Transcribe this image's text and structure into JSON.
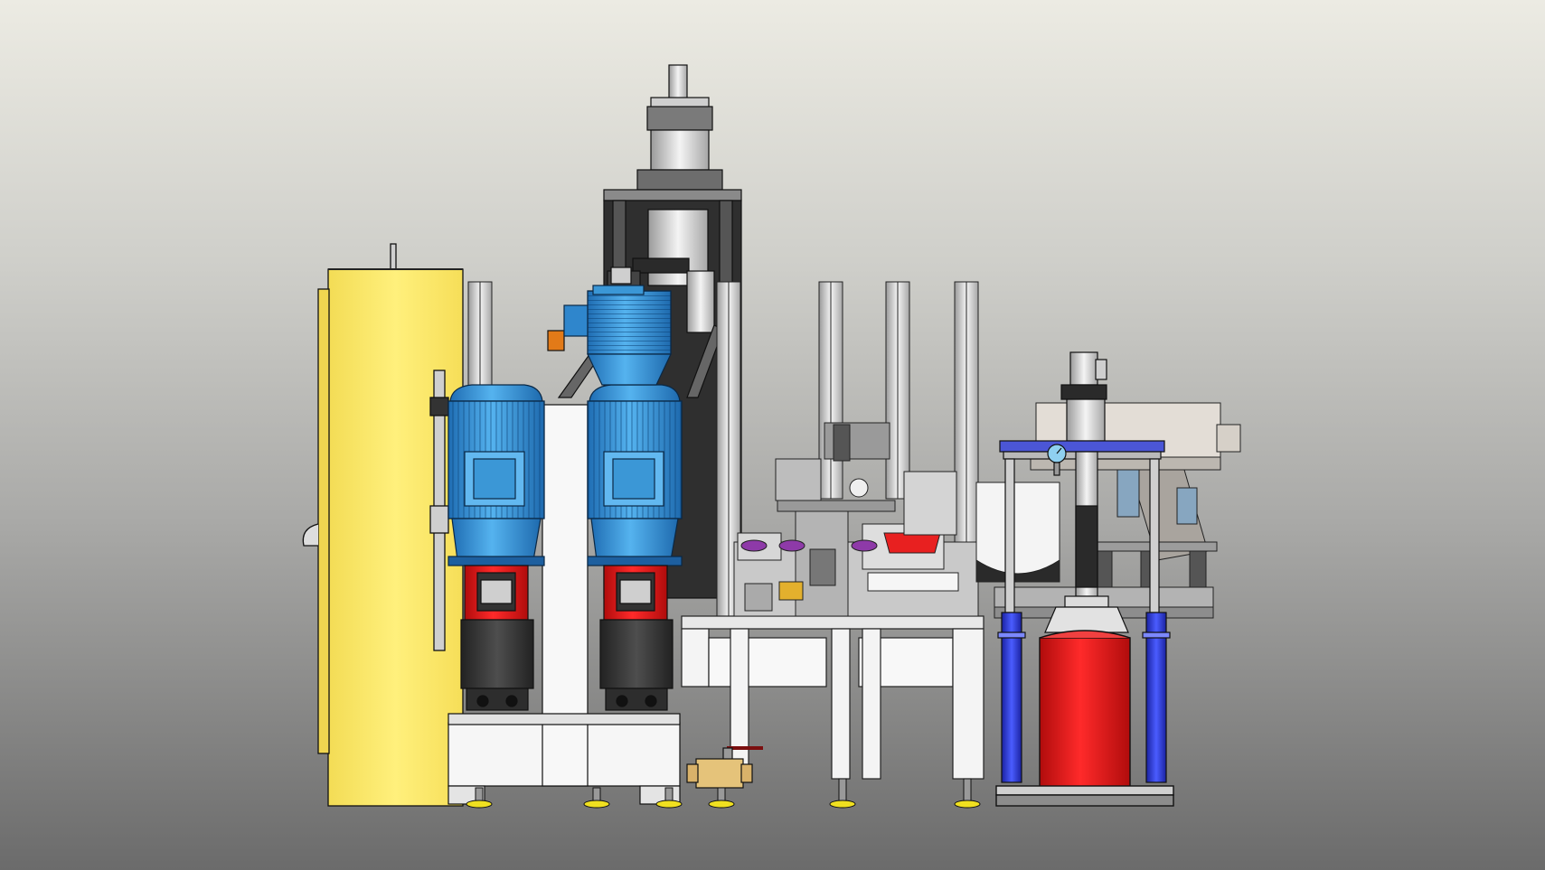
{
  "scene": {
    "kind": "CAD machine assembly render",
    "background": {
      "top": "#ecebe3",
      "bottom": "#6b6b6b"
    },
    "components": [
      {
        "name": "electrical-cabinet",
        "color": "#fde96a"
      },
      {
        "name": "motor-1",
        "color": "#3d9ad8"
      },
      {
        "name": "motor-2",
        "color": "#3d9ad8"
      },
      {
        "name": "top-motor",
        "color": "#3d9ad8"
      },
      {
        "name": "coupling-1",
        "color": "#d82020"
      },
      {
        "name": "coupling-2",
        "color": "#d82020"
      },
      {
        "name": "press-column",
        "color": "#4a4a4a"
      },
      {
        "name": "press-cylinder",
        "color": "#b8b8b8"
      },
      {
        "name": "machine-table",
        "color": "#f2f2f2"
      },
      {
        "name": "aluminum-posts",
        "color": "#d0d0d0"
      },
      {
        "name": "red-tank",
        "color": "#e81010"
      },
      {
        "name": "blue-cylinders",
        "color": "#2e3cd8"
      },
      {
        "name": "pressure-gauge",
        "color": "#8fd0f0"
      },
      {
        "name": "feed-hopper",
        "color": "#e3ddd6"
      },
      {
        "name": "ball-valve",
        "color": "#e5c37a"
      },
      {
        "name": "leveling-feet",
        "color": "#f0e020"
      }
    ]
  }
}
